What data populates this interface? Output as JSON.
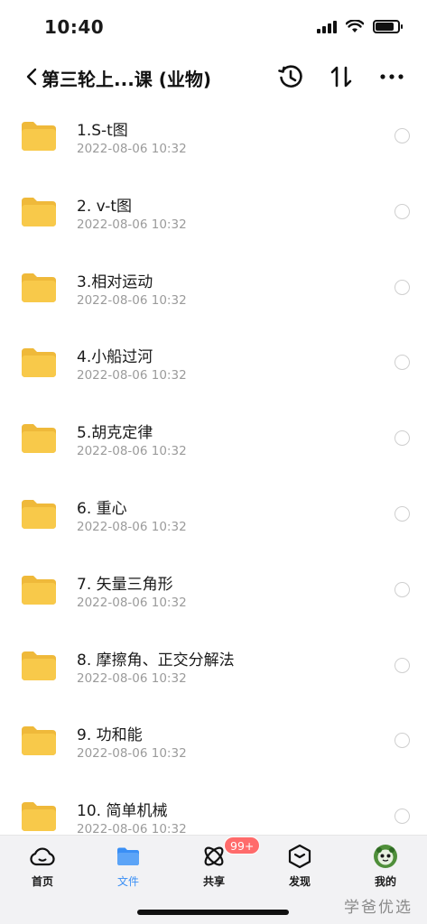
{
  "status_bar": {
    "time": "10:40",
    "battery_level": 0.85,
    "icons": [
      "cellular-signal-icon",
      "wifi-icon",
      "battery-icon"
    ]
  },
  "nav": {
    "title": "第三轮上...课 (业物)",
    "icons": [
      "back-chevron-icon",
      "history-icon",
      "sort-icon",
      "more-icon"
    ]
  },
  "files": [
    {
      "name": "1.S-t图",
      "date": "2022-08-06 10:32"
    },
    {
      "name": "2. v-t图",
      "date": "2022-08-06 10:32"
    },
    {
      "name": "3.相对运动",
      "date": "2022-08-06 10:32"
    },
    {
      "name": "4.小船过河",
      "date": "2022-08-06 10:32"
    },
    {
      "name": "5.胡克定律",
      "date": "2022-08-06 10:32"
    },
    {
      "name": "6. 重心",
      "date": "2022-08-06 10:32"
    },
    {
      "name": "7. 矢量三角形",
      "date": "2022-08-06 10:32"
    },
    {
      "name": "8. 摩擦角、正交分解法",
      "date": "2022-08-06 10:32"
    },
    {
      "name": "9. 功和能",
      "date": "2022-08-06 10:32"
    },
    {
      "name": "10. 简单机械",
      "date": "2022-08-06 10:32"
    }
  ],
  "tabs": [
    {
      "label": "首页",
      "icon": "home-cloud-icon",
      "active": false
    },
    {
      "label": "文件",
      "icon": "folder-icon",
      "active": true
    },
    {
      "label": "共享",
      "icon": "share-orbit-icon",
      "active": false,
      "badge": "99+"
    },
    {
      "label": "发现",
      "icon": "discover-box-icon",
      "active": false
    },
    {
      "label": "我的",
      "icon": "avatar-icon",
      "active": false
    }
  ],
  "watermark": "学爸优选",
  "colors": {
    "folder": "#f8c94a",
    "folder_tab": "#efb93a",
    "active_tab": "#3a8ff5",
    "badge": "#ff6b6b",
    "date_text": "#9b9b9b"
  }
}
